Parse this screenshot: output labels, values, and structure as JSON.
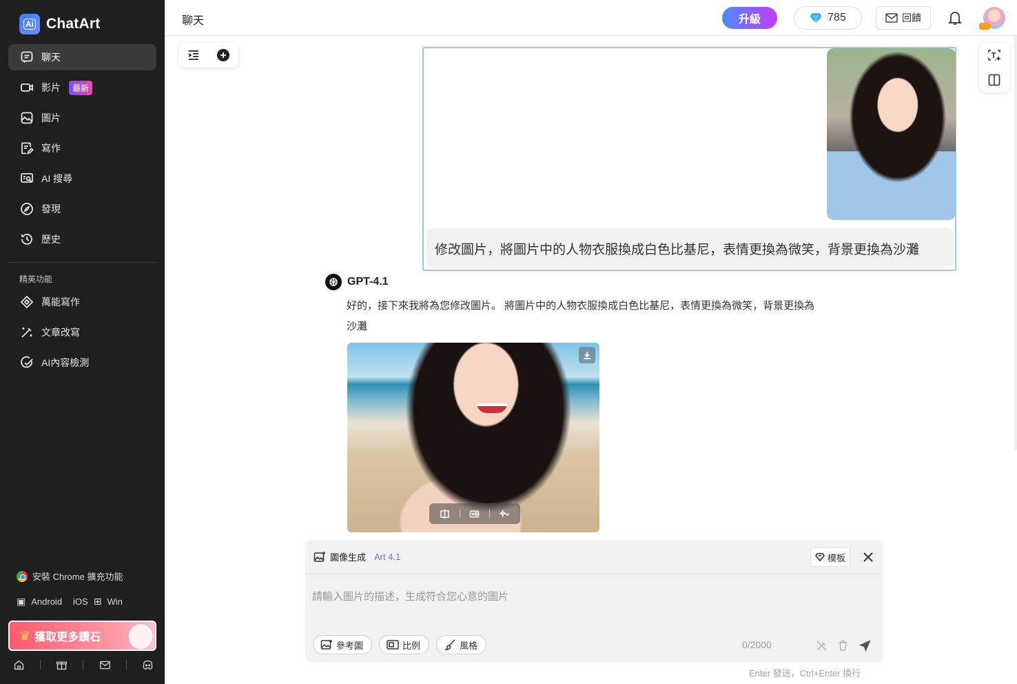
{
  "app": {
    "name": "ChatArt",
    "logo_mark": "Ai"
  },
  "sidebar": {
    "nav": [
      {
        "label": "聊天",
        "icon": "chat-icon"
      },
      {
        "label": "影片",
        "icon": "video-icon",
        "badge": "最新"
      },
      {
        "label": "圖片",
        "icon": "image-icon"
      },
      {
        "label": "寫作",
        "icon": "write-icon"
      },
      {
        "label": "AI 搜尋",
        "icon": "ai-search-icon"
      },
      {
        "label": "發現",
        "icon": "compass-icon"
      },
      {
        "label": "歷史",
        "icon": "history-icon"
      }
    ],
    "section_title": "精英功能",
    "elite": [
      {
        "label": "萬能寫作",
        "icon": "diamond-pen-icon"
      },
      {
        "label": "文章改寫",
        "icon": "magic-wand-icon"
      },
      {
        "label": "AI內容檢測",
        "icon": "check-circle-icon"
      }
    ],
    "chrome_link": "安裝 Chrome 擴充功能",
    "platforms": {
      "android": "Android",
      "ios": "iOS",
      "win": "Win"
    },
    "promo": "獲取更多鑽石",
    "bottom_icons": [
      "home-icon",
      "gift-icon",
      "mail-icon",
      "discord-icon"
    ]
  },
  "topbar": {
    "title": "聊天",
    "upgrade": "升級",
    "gems": "785",
    "feedback": "回饋"
  },
  "chat": {
    "user_message": "修改圖片，將圖片中的人物衣服換成白色比基尼，表情更換為微笑，背景更換為沙灘",
    "bot_name": "GPT-4.1",
    "bot_text_line1": "好的，接下來我將為您修改圖片。 將圖片中的人物衣服換成白色比基尼，表情更換為微笑，背景更換為",
    "bot_text_line2": "沙灘"
  },
  "composer": {
    "mode": "圖像生成",
    "model": "Art 4.1",
    "template": "模板",
    "placeholder": "請輸入圖片的描述，生成符合您心意的圖片",
    "value": "",
    "chips": [
      "參考圖",
      "比例",
      "風格"
    ],
    "counter": "0/2000",
    "hint": "Enter 發送，Ctrl+Enter 換行"
  },
  "colors": {
    "sidebar_bg": "#1f1f1f",
    "accent_blue": "#4a8bff",
    "accent_purple": "#c63bff",
    "user_border": "#9cc3ff",
    "model_tag": "#9b59f0"
  }
}
